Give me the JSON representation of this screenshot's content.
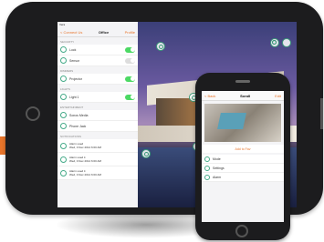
{
  "tablet": {
    "status_time": "Vera",
    "nav": {
      "back": "< Connect Us",
      "title": "Office",
      "right": "Profile"
    },
    "sections": [
      {
        "header": "Security",
        "rows": [
          {
            "icon": "lock-icon",
            "label": "Lock",
            "on": true
          },
          {
            "icon": "motion-icon",
            "label": "Sensor",
            "on": false
          }
        ]
      },
      {
        "header": "Dimmers",
        "rows": [
          {
            "icon": "bulb-icon",
            "label": "Projector",
            "on": true
          }
        ]
      },
      {
        "header": "Lights",
        "rows": [
          {
            "icon": "bulb-icon",
            "label": "Light 1",
            "on": true
          }
        ]
      },
      {
        "header": "Entertainment",
        "rows": [
          {
            "icon": "tv-icon",
            "label": "Sonos Media"
          },
          {
            "icon": "camera-icon",
            "label": "Phone Jack"
          }
        ]
      },
      {
        "header": "Notifications",
        "rows": [
          {
            "icon": "clock-icon",
            "label": "Alarm used",
            "sub": "Wed, 3 Dec 2014 6:00 AM"
          },
          {
            "icon": "clock-icon",
            "label": "Alarm used it",
            "sub": "Wed, 3 Dec 2014 6:00 AM"
          },
          {
            "icon": "clock-icon",
            "label": "Alarm used it",
            "sub": "Wed, 3 Dec 2014 6:00 AM"
          }
        ]
      }
    ]
  },
  "phone": {
    "nav": {
      "back": "< Back",
      "title": "Scroll",
      "right": "Edit"
    },
    "action": "Add to Fav",
    "rows": [
      {
        "icon": "light-icon",
        "label": "Mode"
      },
      {
        "icon": "light-icon",
        "label": "Settings"
      },
      {
        "icon": "light-icon",
        "label": "Alarm"
      }
    ]
  },
  "colors": {
    "accent": "#e8742a",
    "toggle_on": "#4cd964",
    "hotspot": "#3a9a78"
  }
}
